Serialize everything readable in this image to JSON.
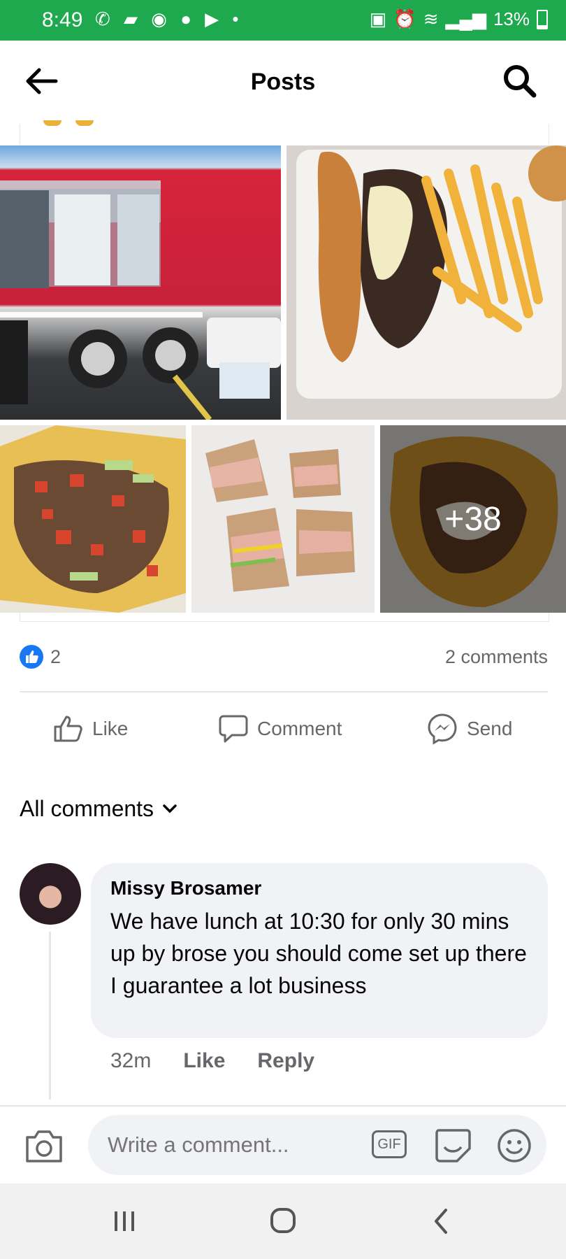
{
  "status_bar": {
    "time": "8:49",
    "battery": "13%"
  },
  "header": {
    "title": "Posts"
  },
  "photos": {
    "more_count": "+38"
  },
  "reactions": {
    "like_count": "2",
    "comments_count": "2 comments"
  },
  "actions": {
    "like": "Like",
    "comment": "Comment",
    "send": "Send"
  },
  "comments_filter": {
    "label": "All comments"
  },
  "comment": {
    "author": "Missy Brosamer",
    "text": "We have lunch at 10:30 for only 30 mins up by brose you should come set up there I guarantee a lot business",
    "time": "32m",
    "like": "Like",
    "reply": "Reply"
  },
  "composer": {
    "placeholder": "Write a comment...",
    "gif": "GIF"
  },
  "colors": {
    "status_bar": "#1fa94f",
    "facebook_blue": "#1877f2",
    "bubble": "#f0f2f5",
    "secondary_text": "#65676b"
  }
}
